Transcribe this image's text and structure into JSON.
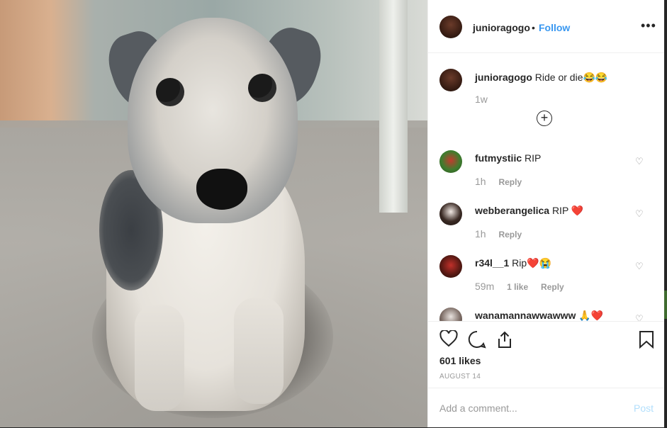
{
  "post": {
    "image_alt": "Schnauzer mix dog sitting on carpet",
    "author": "junioragogo",
    "separator": "•",
    "follow_label": "Follow",
    "more_label": "•••"
  },
  "caption": {
    "username": "junioragogo",
    "text": "Ride or die",
    "emoji": "😂😂",
    "time": "1w",
    "load_more_symbol": "+"
  },
  "comments": [
    {
      "username": "futmystiic",
      "text": "RIP",
      "emoji": "",
      "time": "1h",
      "likes": "",
      "reply": "Reply"
    },
    {
      "username": "webberangelica",
      "text": "RIP",
      "emoji": "❤️",
      "time": "1h",
      "likes": "",
      "reply": "Reply"
    },
    {
      "username": "r34l__1",
      "text": "Rip",
      "emoji": "❤️😭",
      "time": "59m",
      "likes": "1 like",
      "reply": "Reply"
    },
    {
      "username": "wanamannawwawww",
      "text": "",
      "emoji": "🙏❤️",
      "time": "",
      "likes": "",
      "reply": ""
    }
  ],
  "actions": {
    "likes": "601 likes",
    "date": "AUGUST 14"
  },
  "add_comment": {
    "placeholder": "Add a comment...",
    "post_label": "Post"
  },
  "colors": {
    "accent": "#3897f0",
    "post_disabled": "#b2dffc",
    "muted": "#999999",
    "text": "#262626"
  }
}
